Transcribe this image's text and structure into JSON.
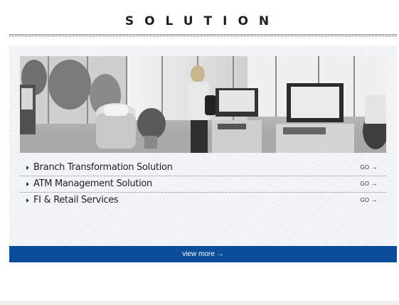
{
  "title": "SOLUTION",
  "hero_image": {
    "alt": "Self-service banking kiosk photo"
  },
  "items": [
    {
      "label": "Branch Transformation Solution",
      "go": "GO"
    },
    {
      "label": "ATM Management Solution",
      "go": "GO"
    },
    {
      "label": "FI & Retail Services",
      "go": "GO"
    }
  ],
  "view_more": "view more",
  "colors": {
    "accent_blue": "#0b4d9a",
    "arrow_blue": "#1d3f7a",
    "panel_bg": "#eef0f3"
  },
  "icons": {
    "item_bullet": "caret-right-icon",
    "go_arrow": "arrow-right-icon",
    "view_more_arrow": "arrow-right-icon"
  }
}
